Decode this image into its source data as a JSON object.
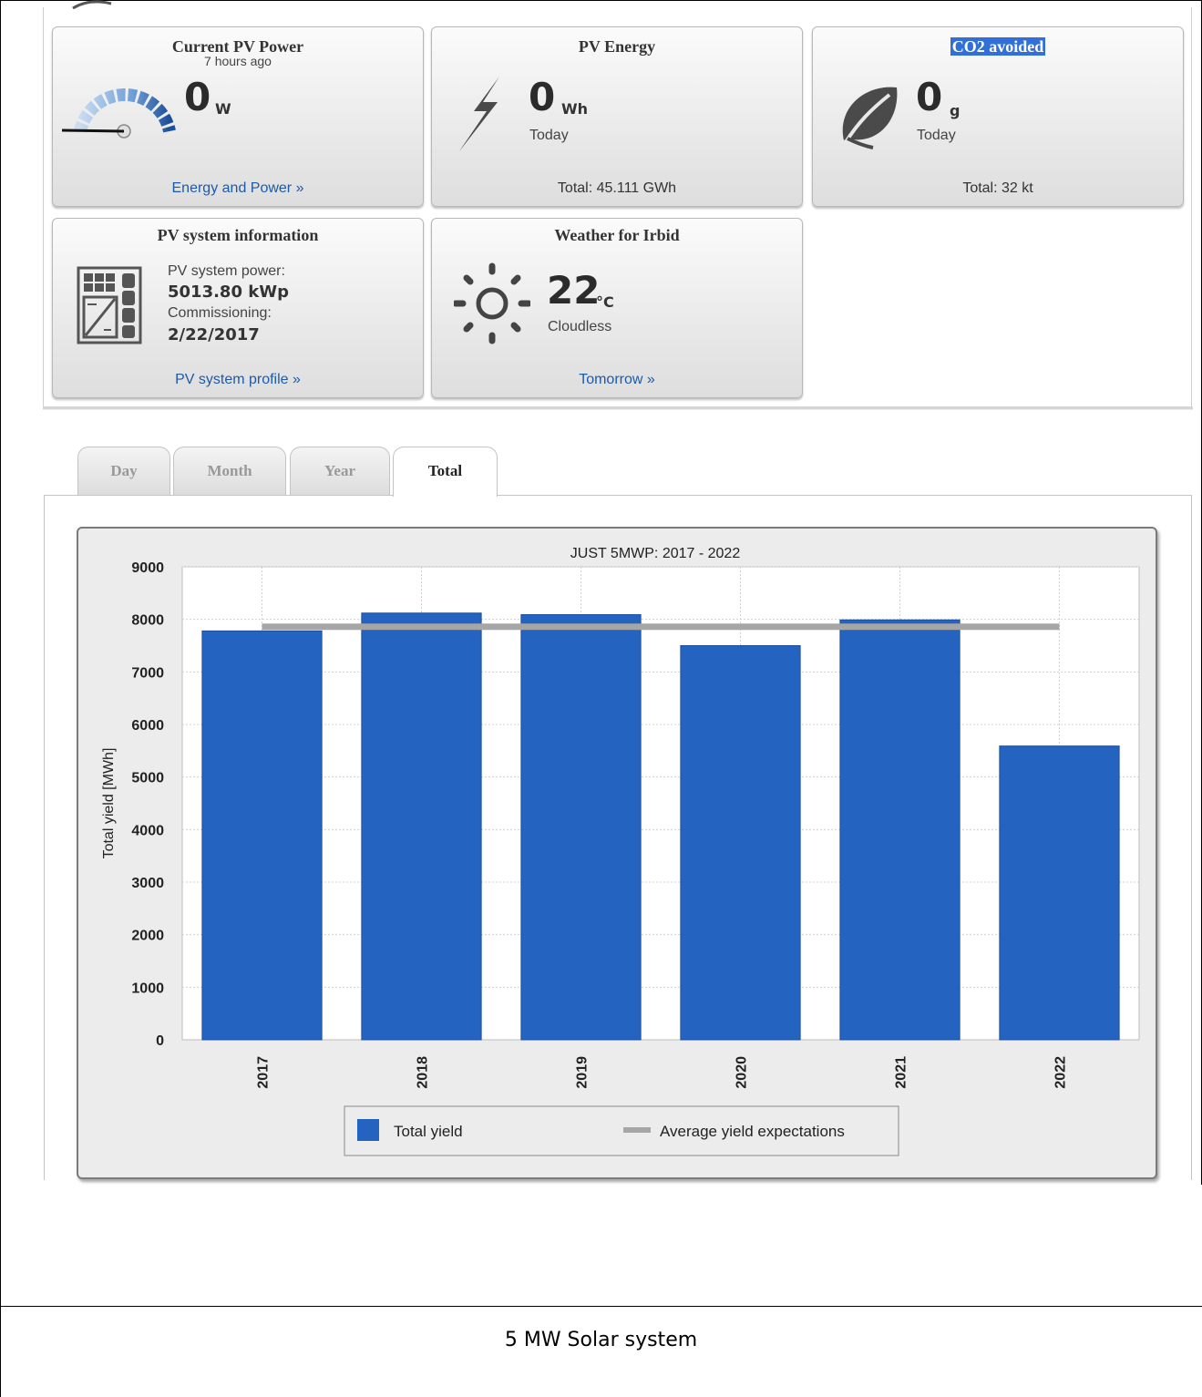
{
  "cards": {
    "current_power": {
      "title": "Current PV Power",
      "subtitle": "7 hours ago",
      "value": "0",
      "unit": "W",
      "link": "Energy and Power »"
    },
    "pv_energy": {
      "title": "PV Energy",
      "value": "0",
      "unit": "Wh",
      "period": "Today",
      "total": "Total: 45.111 GWh"
    },
    "co2": {
      "title": "CO2 avoided",
      "value": "0",
      "unit": "g",
      "period": "Today",
      "total": "Total: 32 kt"
    },
    "system_info": {
      "title": "PV system information",
      "power_label": "PV system power:",
      "power_value": "5013.80 kWp",
      "commissioning_label": "Commissioning:",
      "commissioning_value": "2/22/2017",
      "link": "PV system profile »"
    },
    "weather": {
      "title": "Weather for Irbid",
      "value": "22",
      "unit": "°C",
      "condition": "Cloudless",
      "link": "Tomorrow »"
    }
  },
  "tabs": [
    {
      "label": "Day"
    },
    {
      "label": "Month"
    },
    {
      "label": "Year"
    },
    {
      "label": "Total"
    }
  ],
  "active_tab": "Total",
  "chart_data": {
    "type": "bar",
    "title": "JUST 5MWP: 2017 - 2022",
    "ylabel": "Total yield [MWh]",
    "xlabel": "",
    "categories": [
      "2017",
      "2018",
      "2019",
      "2020",
      "2021",
      "2022"
    ],
    "series": [
      {
        "name": "Total yield",
        "type": "bar",
        "color": "#2563c0",
        "values": [
          7780,
          8120,
          8090,
          7500,
          7990,
          5590
        ]
      },
      {
        "name": "Average yield expectations",
        "type": "line",
        "color": "#a6a6a6",
        "values": [
          7860,
          7860,
          7860,
          7860,
          7860,
          7860
        ]
      }
    ],
    "ylim": [
      0,
      9000
    ],
    "yticks": [
      "0",
      "1000",
      "2000",
      "3000",
      "4000",
      "5000",
      "6000",
      "7000",
      "8000",
      "9000"
    ],
    "grid": true,
    "legend": "bottom"
  },
  "caption": "5 MW Solar system",
  "colors": {
    "link": "#1f5aa6",
    "bar": "#2563c0",
    "highlight": "#3170d8"
  }
}
